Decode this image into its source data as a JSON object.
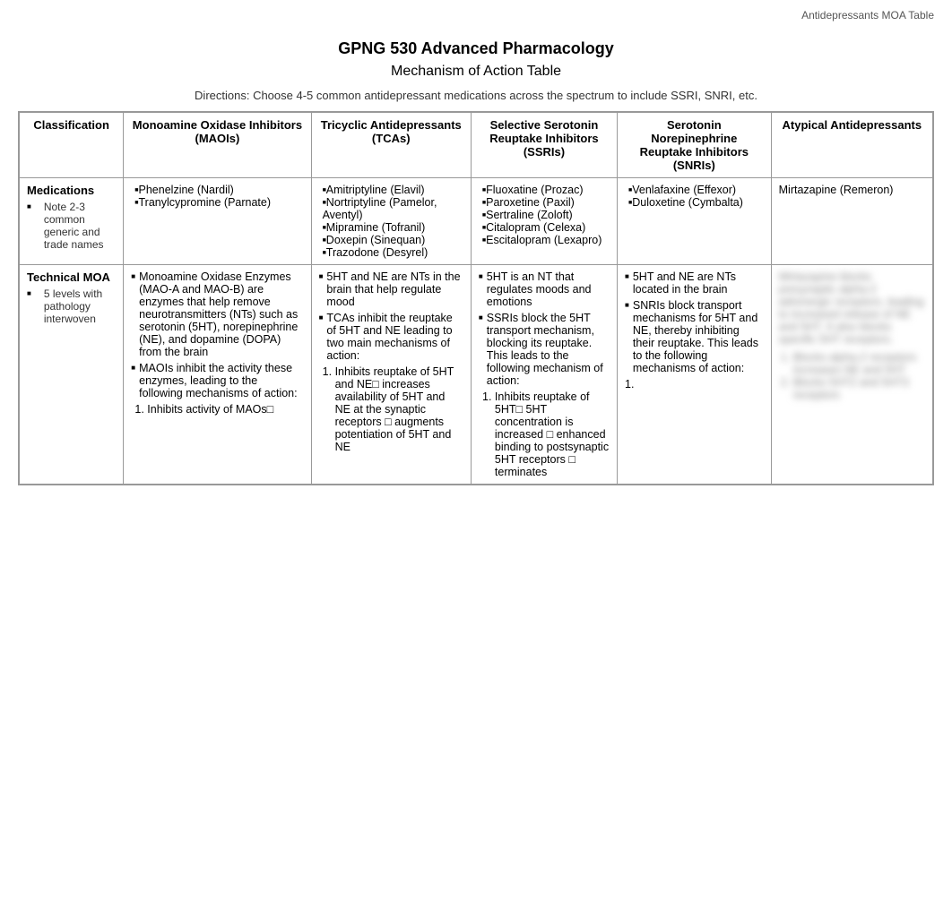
{
  "watermark": "Antidepressants MOA Table",
  "title": "GPNG 530 Advanced Pharmacology",
  "subtitle": "Mechanism of Action Table",
  "directions": "Directions: Choose 4-5 common antidepressant medications across the spectrum to include SSRI, SNRI, etc.",
  "headers": {
    "col0": "Classification",
    "col1": "Monoamine Oxidase Inhibitors (MAOIs)",
    "col2": "Tricyclic Antidepressants (TCAs)",
    "col3": "Selective Serotonin Reuptake Inhibitors (SSRIs)",
    "col4": "Serotonin Norepinephrine Reuptake Inhibitors (SNRIs)",
    "col5": "Atypical Antidepressants"
  },
  "row1": {
    "label": "Medications",
    "sublabel": "Note 2-3 common generic and trade names",
    "col1": [
      "Phenelzine (Nardil)",
      "Tranylcypromine (Parnate)"
    ],
    "col2": [
      "Amitriptyline (Elavil)",
      "Nortriptyline (Pamelor, Aventyl)",
      "Mipramine (Tofranil)",
      "Doxepin (Sinequan)",
      "Trazodone (Desyrel)"
    ],
    "col3": [
      "Fluoxatine (Prozac)",
      "Paroxetine (Paxil)",
      "Sertraline (Zoloft)",
      "Citalopram (Celexa)",
      "Escitalopram (Lexapro)"
    ],
    "col4": [
      "Venlafaxine (Effexor)",
      "Duloxetine (Cymbalta)"
    ],
    "col5": "Mirtazapine (Remeron)"
  },
  "row2": {
    "label": "Technical MOA",
    "sublabel": "5 levels with pathology interwoven",
    "col1_intro": "Monoamine Oxidase Enzymes (MAO-A and MAO-B) are enzymes that help remove neurotransmitters (NTs) such as serotonin (5HT), norepinephrine (NE), and dopamine (DOPA) from the brain",
    "col1_point2": "MAOIs inhibit the activity these enzymes, leading to the following mechanisms of action:",
    "col1_ordered": [
      "Inhibits activity of MAOs□"
    ],
    "col2_intro": "5HT and NE are NTs in the brain that help regulate mood",
    "col2_point2": "TCAs inhibit the reuptake of 5HT and NE leading to two main mechanisms of action:",
    "col2_ordered_1": "Inhibits reuptake of 5HT and NE□ increases availability of 5HT and NE at the synaptic receptors □ augments potentiation of 5HT and NE",
    "col3_intro": "5HT is an NT that regulates moods and emotions",
    "col3_point2": "SSRIs block the 5HT transport mechanism, blocking its reuptake. This leads to the following mechanism of action:",
    "col3_ordered_1": "Inhibits reuptake of 5HT□  5HT concentration is increased □ enhanced binding to postsynaptic 5HT receptors □ terminates",
    "col4_intro": "5HT and NE are NTs located in the brain",
    "col4_point2": "SNRIs block transport mechanisms for 5HT and NE, thereby inhibiting their reuptake. This leads to the following mechanisms of action:",
    "col4_ordered_1": "1.",
    "col5_blurred": true
  }
}
